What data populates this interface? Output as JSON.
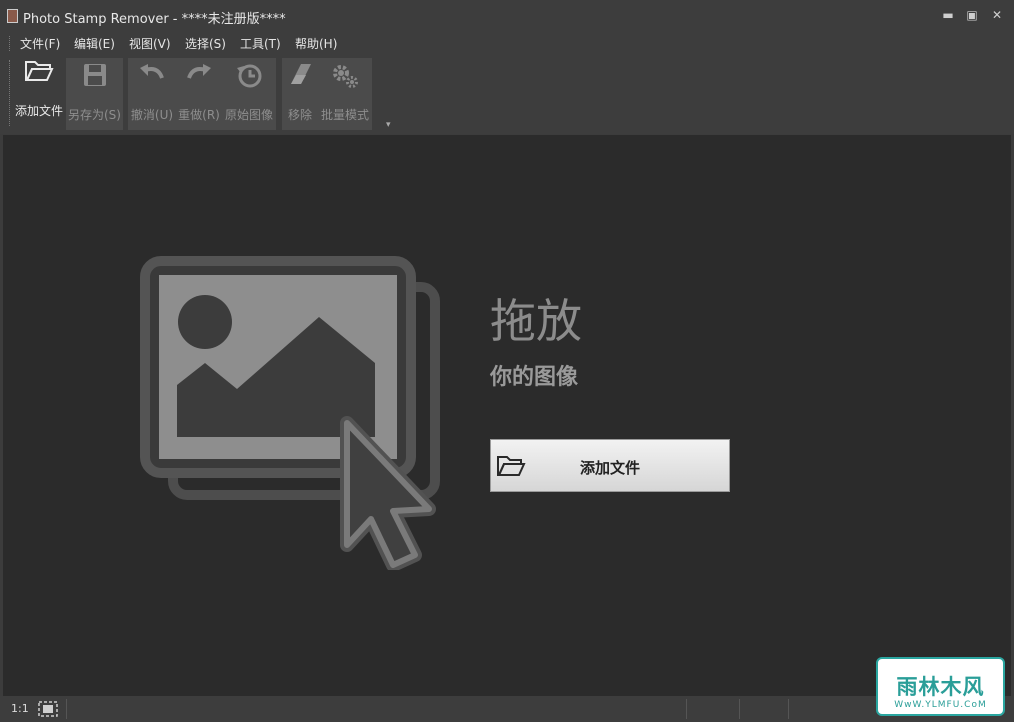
{
  "window": {
    "title": "Photo Stamp Remover - ****未注册版****",
    "minimize": "▬",
    "maximize": "▣",
    "close": "✕"
  },
  "menu": {
    "items": [
      {
        "label": "文件(F)"
      },
      {
        "label": "编辑(E)"
      },
      {
        "label": "视图(V)"
      },
      {
        "label": "选择(S)"
      },
      {
        "label": "工具(T)"
      },
      {
        "label": "帮助(H)"
      }
    ]
  },
  "toolbar": {
    "buttons": [
      {
        "label": "添加文件",
        "icon": "folder-open-icon",
        "enabled": true
      },
      {
        "label": "另存为(S)",
        "icon": "save-icon",
        "enabled": false
      },
      {
        "label": "撤消(U)",
        "icon": "undo-icon",
        "enabled": false
      },
      {
        "label": "重做(R)",
        "icon": "redo-icon",
        "enabled": false
      },
      {
        "label": "原始图像",
        "icon": "history-icon",
        "enabled": false
      },
      {
        "label": "移除",
        "icon": "eraser-icon",
        "enabled": false
      },
      {
        "label": "批量模式",
        "icon": "gears-icon",
        "enabled": false
      }
    ],
    "overflow": "▾"
  },
  "main": {
    "drop_title": "拖放",
    "drop_subtitle": "你的图像",
    "add_button_label": "添加文件"
  },
  "status": {
    "zoom": "1:1"
  },
  "watermark": {
    "text": "雨林木风",
    "url": "WwW.YLMFU.CoM"
  },
  "colors": {
    "window_bg": "#3c3c3c",
    "canvas_bg": "#2b2b2b",
    "watermark": "#2a9e98"
  }
}
